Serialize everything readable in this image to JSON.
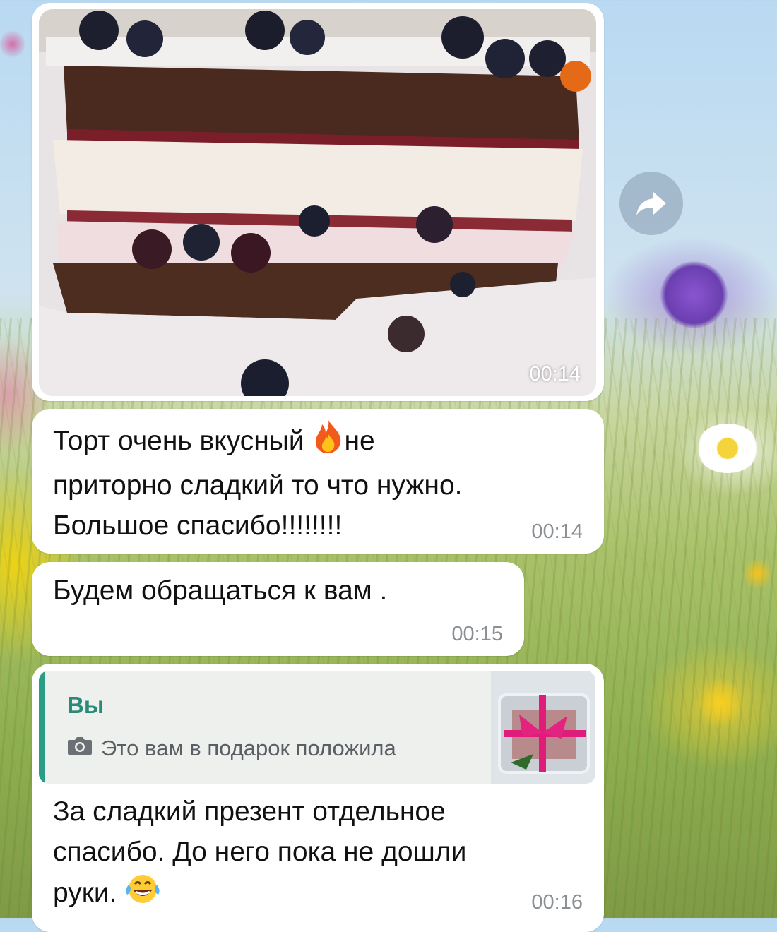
{
  "messages": [
    {
      "type": "photo",
      "time": "00:14"
    },
    {
      "type": "text",
      "lines": [
        "Торт очень вкусный",
        "не",
        "приторно сладкий то что нужно.",
        "Большое спасибо!!!!!!!!"
      ],
      "emoji": "fire-icon",
      "time": "00:14"
    },
    {
      "type": "text",
      "lines": [
        "Будем обращаться к вам ."
      ],
      "time": "00:15"
    },
    {
      "type": "reply",
      "quote": {
        "author": "Вы",
        "caption": "Это вам в подарок положила",
        "icon": "camera-icon"
      },
      "lines": [
        "За сладкий презент отдельное",
        "спасибо. До него пока не дошли",
        "руки."
      ],
      "emoji": "face-with-tears-of-joy-icon",
      "time": "00:16"
    }
  ],
  "colors": {
    "bubble": "#ffffff",
    "reply_accent": "#2a9d87",
    "time": "#8a8f94"
  }
}
